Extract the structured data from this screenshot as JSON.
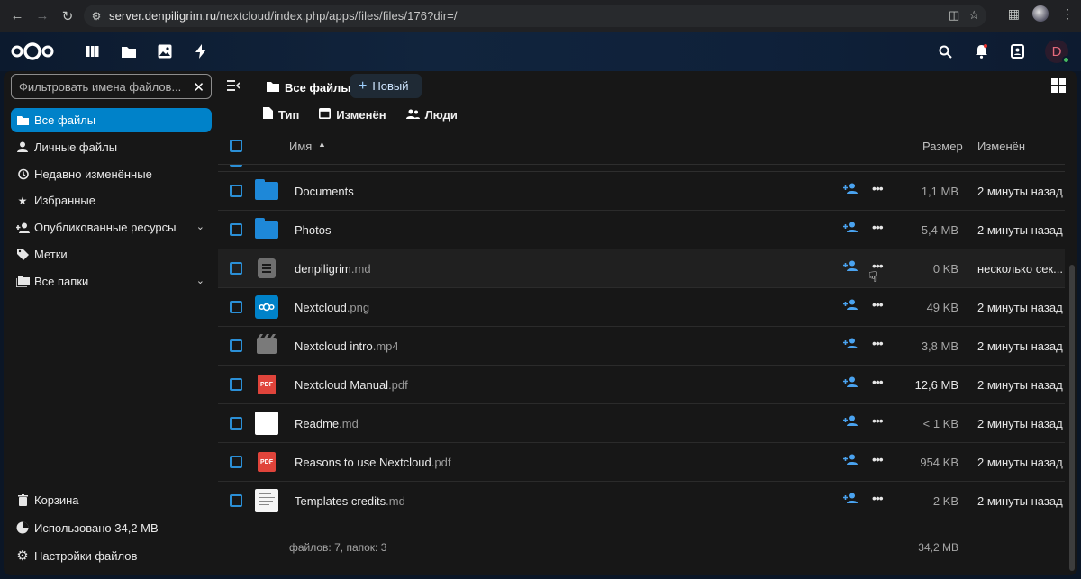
{
  "browser": {
    "url_host": "server.denpiligrim.ru",
    "url_path": "/nextcloud/index.php/apps/files/files/176?dir=/"
  },
  "header": {
    "avatar_letter": "D"
  },
  "sidebar": {
    "filter_placeholder": "Фильтровать имена файлов...",
    "items": [
      {
        "label": "Все файлы",
        "icon": "folder-icon",
        "active": true
      },
      {
        "label": "Личные файлы",
        "icon": "person-icon"
      },
      {
        "label": "Недавно изменённые",
        "icon": "history-icon"
      },
      {
        "label": "Избранные",
        "icon": "star-icon"
      },
      {
        "label": "Опубликованные ресурсы",
        "icon": "share-person-icon",
        "expandable": true
      },
      {
        "label": "Метки",
        "icon": "tag-icon"
      },
      {
        "label": "Все папки",
        "icon": "folders-icon",
        "expandable": true
      }
    ],
    "bottom": {
      "trash": "Корзина",
      "quota": "Использовано 34,2 МВ",
      "settings": "Настройки файлов"
    }
  },
  "main": {
    "breadcrumb": "Все файлы",
    "new_button": "Новый",
    "filters": {
      "type": "Тип",
      "modified": "Изменён",
      "people": "Люди"
    },
    "columns": {
      "name": "Имя",
      "size": "Размер",
      "modified": "Изменён"
    },
    "files": [
      {
        "name": "Documents",
        "ext": "",
        "kind": "folder",
        "size": "1,1 MB",
        "modified": "2 минуты назад"
      },
      {
        "name": "Photos",
        "ext": "",
        "kind": "folder",
        "size": "5,4 MB",
        "modified": "2 минуты назад"
      },
      {
        "name": "denpiligrim",
        "ext": ".md",
        "kind": "doc",
        "size": "0 KB",
        "modified": "несколько сек...",
        "hover": true
      },
      {
        "name": "Nextcloud",
        "ext": ".png",
        "kind": "png",
        "size": "49 KB",
        "modified": "2 минуты назад"
      },
      {
        "name": "Nextcloud intro",
        "ext": ".mp4",
        "kind": "video",
        "size": "3,8 MB",
        "modified": "2 минуты назад"
      },
      {
        "name": "Nextcloud Manual",
        "ext": ".pdf",
        "kind": "pdf",
        "size": "12,6 MB",
        "modified": "2 минуты назад",
        "size_bright": true
      },
      {
        "name": "Readme",
        "ext": ".md",
        "kind": "white",
        "size": "< 1 KB",
        "modified": "2 минуты назад"
      },
      {
        "name": "Reasons to use Nextcloud",
        "ext": ".pdf",
        "kind": "pdf",
        "size": "954 KB",
        "modified": "2 минуты назад"
      },
      {
        "name": "Templates credits",
        "ext": ".md",
        "kind": "template",
        "size": "2 KB",
        "modified": "2 минуты назад"
      }
    ],
    "summary": "файлов: 7, папок: 3",
    "total_size": "34,2 MB"
  },
  "colors": {
    "accent": "#0082c9",
    "folder": "#1e88d8",
    "pdf": "#e0443b"
  }
}
